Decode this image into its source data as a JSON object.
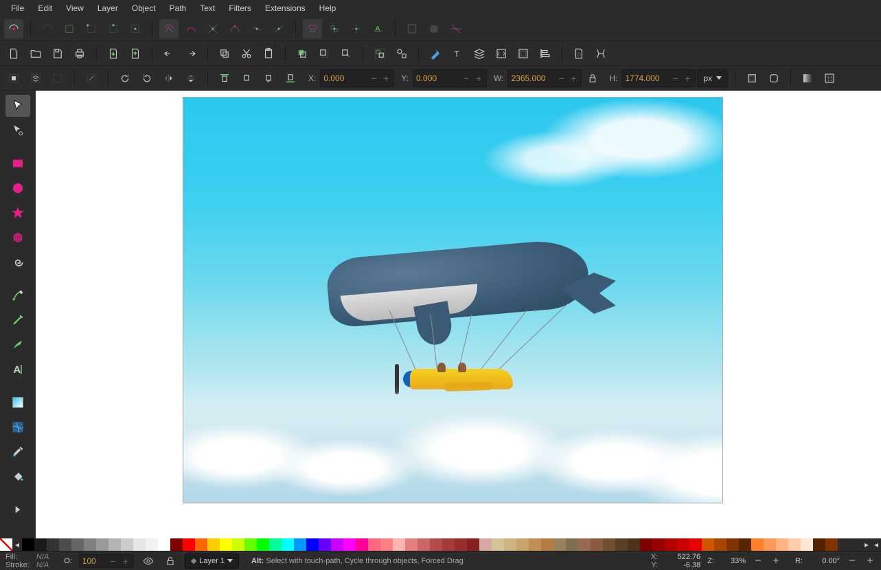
{
  "menu": {
    "items": [
      "File",
      "Edit",
      "View",
      "Layer",
      "Object",
      "Path",
      "Text",
      "Filters",
      "Extensions",
      "Help"
    ]
  },
  "toolbar_row3": {
    "x_label": "X:",
    "x_value": "0.000",
    "y_label": "Y:",
    "y_value": "0.000",
    "w_label": "W:",
    "w_value": "2365.000",
    "h_label": "H:",
    "h_value": "1774.000",
    "units": "px"
  },
  "palette_colors": [
    "none",
    "#000000",
    "#1a1a1a",
    "#333333",
    "#4d4d4d",
    "#666666",
    "#808080",
    "#999999",
    "#b3b3b3",
    "#cccccc",
    "#e6e6e6",
    "#f2f2f2",
    "#ffffff",
    "#800000",
    "#ff0000",
    "#ff6600",
    "#ffcc00",
    "#ffff00",
    "#ccff00",
    "#66ff00",
    "#00ff00",
    "#00ff99",
    "#00ffff",
    "#0099ff",
    "#0000ff",
    "#6600ff",
    "#cc00ff",
    "#ff00ff",
    "#ff0099",
    "#ff6680",
    "#ff8080",
    "#ffb3b3",
    "#e68080",
    "#cc6666",
    "#b34d4d",
    "#aa3939",
    "#992d2d",
    "#882020",
    "#d9a6a6",
    "#d4c299",
    "#ccb380",
    "#c9a16b",
    "#bf8f56",
    "#b37d40",
    "#99805c",
    "#807050",
    "#9a6952",
    "#8c5a40",
    "#735030",
    "#594026",
    "#4d331a",
    "#800000",
    "#990000",
    "#b30000",
    "#cc0000",
    "#e60000",
    "#d45500",
    "#aa4400",
    "#803300",
    "#592400",
    "#ff7f2a",
    "#ff9955",
    "#ffb380",
    "#ffccaa",
    "#ffe6d5",
    "#552200",
    "#803300"
  ],
  "status": {
    "fill_label": "Fill:",
    "fill_value": "N/A",
    "stroke_label": "Stroke:",
    "stroke_value": "N/A",
    "opacity_label": "O:",
    "opacity_value": "100",
    "layer_label": "Layer 1",
    "hint_key": "Alt:",
    "hint_text": "Select with touch-path, Cycle through objects, Forced Drag",
    "coord_x_label": "X:",
    "coord_x": "522.76",
    "coord_y_label": "Y:",
    "coord_y": "-6.38",
    "zoom_label": "Z:",
    "zoom": "33%",
    "rot_label": "R:",
    "rot": "0.00°"
  }
}
